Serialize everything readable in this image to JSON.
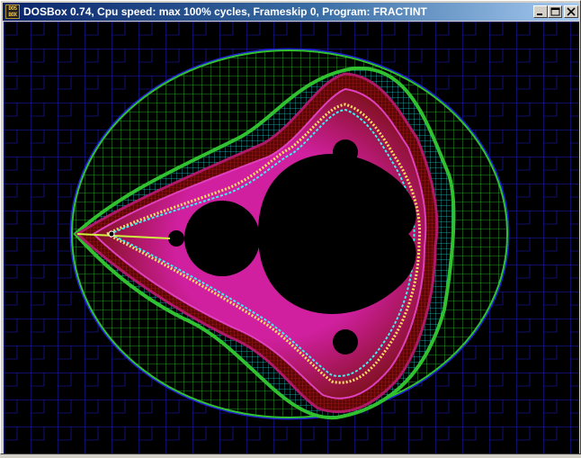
{
  "window": {
    "title": "DOSBox 0.74, Cpu speed: max 100% cycles, Frameskip  0, Program: FRACTINT",
    "icon": "dosbox-icon",
    "icon_text": [
      "DOS",
      "BOX"
    ],
    "controls": [
      "minimize-icon",
      "maximize-icon",
      "close-icon"
    ]
  },
  "screen": {
    "content": "mandelbrot-fractal",
    "colors": {
      "background": "#000000",
      "set": "#000000",
      "outer_grid": "#1c1cc8",
      "green_bands": "#30c030",
      "cyan_band": "#20c8c8",
      "red_band": "#a01818",
      "magenta_band": "#d020a0"
    }
  }
}
